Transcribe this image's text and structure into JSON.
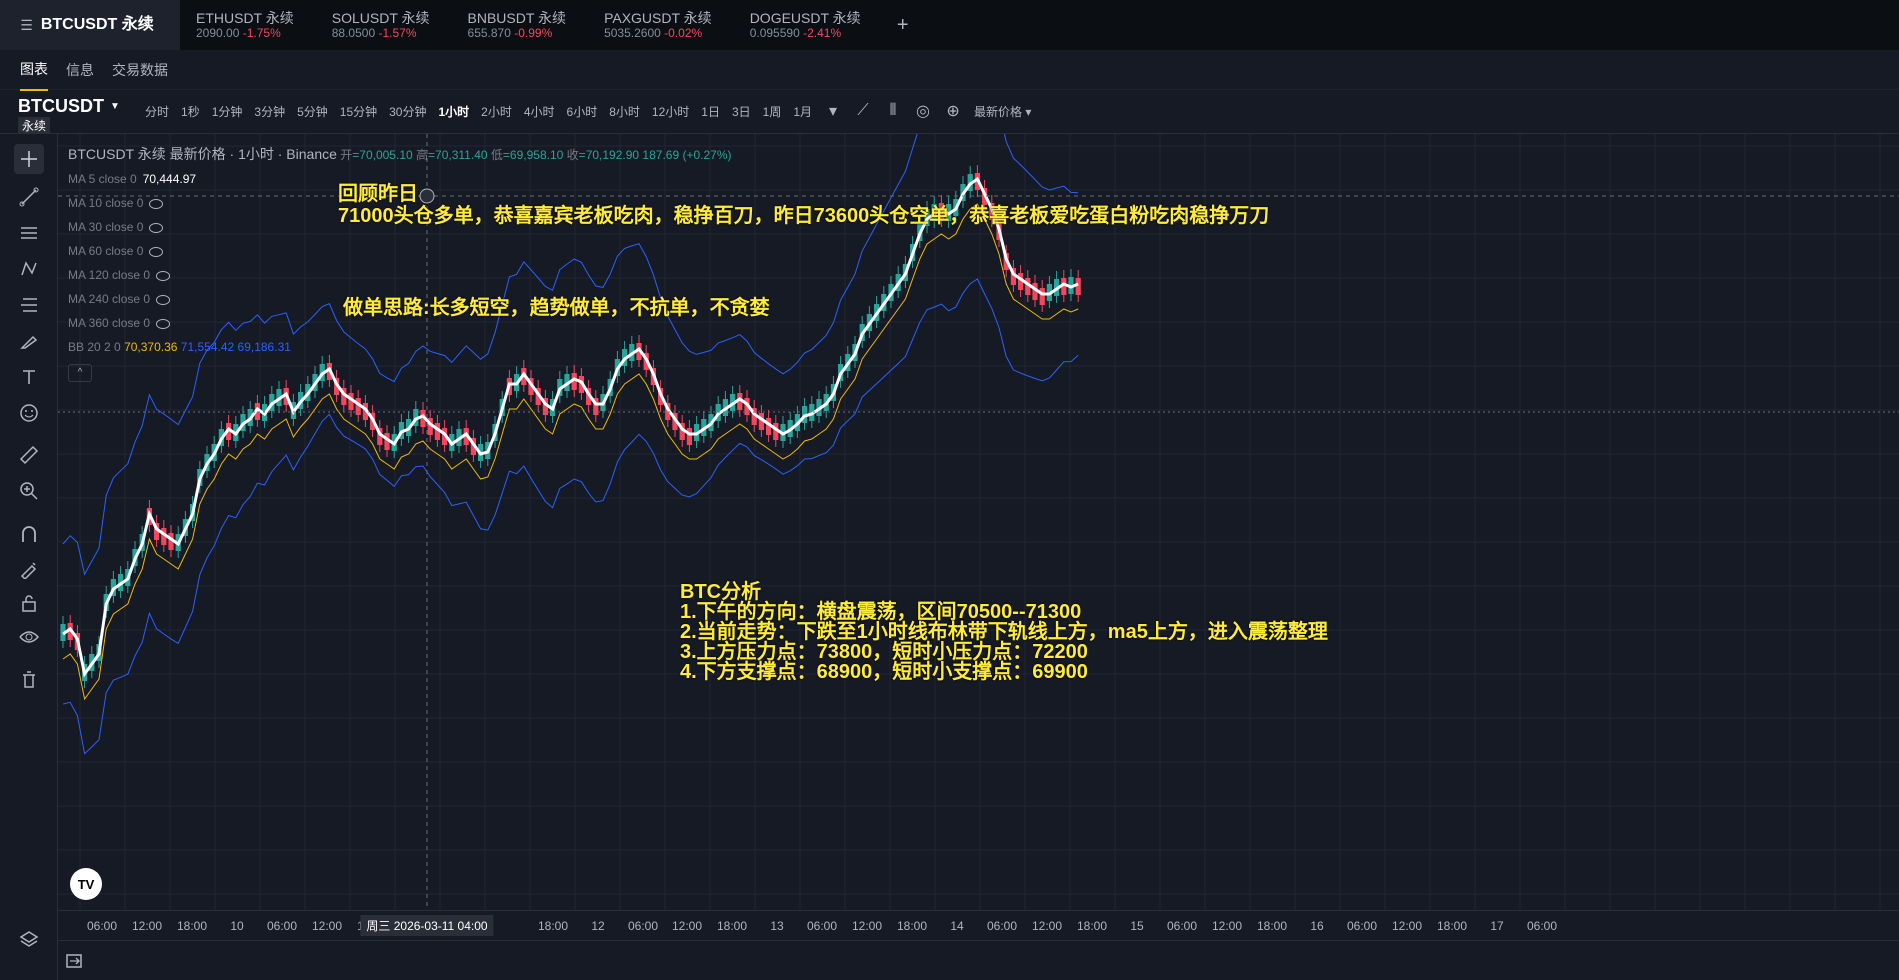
{
  "tabs": [
    {
      "name": "BTCUSDT 永续",
      "sub": "",
      "change": "",
      "active": true
    },
    {
      "name": "ETHUSDT 永续",
      "sub": "2090.00",
      "change": "-1.75%"
    },
    {
      "name": "SOLUSDT 永续",
      "sub": "88.0500",
      "change": "-1.57%"
    },
    {
      "name": "BNBUSDT 永续",
      "sub": "655.870",
      "change": "-0.99%"
    },
    {
      "name": "PAXGUSDT 永续",
      "sub": "5035.2600",
      "change": "-0.02%"
    },
    {
      "name": "DOGEUSDT 永续",
      "sub": "0.095590",
      "change": "-2.41%"
    }
  ],
  "plus_label": "+",
  "subtabs": [
    "图表",
    "信息",
    "交易数据"
  ],
  "symbol": {
    "name": "BTCUSDT",
    "type": "永续"
  },
  "intervals": [
    "分时",
    "1秒",
    "1分钟",
    "3分钟",
    "5分钟",
    "15分钟",
    "30分钟",
    "1小时",
    "2小时",
    "4小时",
    "6小时",
    "8小时",
    "12小时",
    "1日",
    "3日",
    "1周",
    "1月"
  ],
  "active_interval": "1小时",
  "price_type": "最新价格",
  "legend": {
    "title": "BTCUSDT 永续 最新价格 · 1小时 · Binance",
    "open_label": "开",
    "open": "70,005.10",
    "high_label": "高",
    "high": "70,311.40",
    "low_label": "低",
    "low": "69,958.10",
    "close_label": "收",
    "close": "70,192.90",
    "change": "187.69 (+0.27%)",
    "ma": [
      {
        "label": "MA 5 close 0",
        "value": "70,444.97"
      },
      {
        "label": "MA 10 close 0",
        "value": ""
      },
      {
        "label": "MA 30 close 0",
        "value": ""
      },
      {
        "label": "MA 60 close 0",
        "value": ""
      },
      {
        "label": "MA 120 close 0",
        "value": ""
      },
      {
        "label": "MA 240 close 0",
        "value": ""
      },
      {
        "label": "MA 360 close 0",
        "value": ""
      }
    ],
    "bb": {
      "label": "BB 20 2 0",
      "basis": "70,370.36",
      "upper": "71,554.42",
      "lower": "69,186.31"
    },
    "collapse": "^"
  },
  "annotations": {
    "review_title": "回顾昨日",
    "review_body": "71000头仓多单，恭喜嘉宾老板吃肉，稳挣百刀，昨日73600头仓空单，恭喜老板爱吃蛋白粉吃肉稳挣万刀",
    "strategy": "做单思路:长多短空，趋势做单，不抗单，不贪婪",
    "analysis": [
      "BTC分析",
      "1.下午的方向：横盘震荡，区间70500--71300",
      "2.当前走势：下跌至1小时线布林带下轨线上方，ma5上方，进入震荡整理",
      "3.上方压力点：73800，短时小压力点：72200",
      "4.下方支撑点：68900，短时小支撑点：69900"
    ]
  },
  "time_axis": [
    "06:00",
    "12:00",
    "18:00",
    "10",
    "06:00",
    "12:00",
    "18:00",
    "周三 2026-03-11",
    "04:00",
    "18:00",
    "12",
    "06:00",
    "12:00",
    "18:00",
    "13",
    "06:00",
    "12:00",
    "18:00",
    "14",
    "06:00",
    "12:00",
    "18:00",
    "15",
    "06:00",
    "12:00",
    "18:00",
    "16",
    "06:00",
    "12:00",
    "18:00",
    "17",
    "06:00"
  ],
  "crosshair_time": "周三 2026-03-11   04:00",
  "logo": "TV",
  "colors": {
    "up": "#26a69a",
    "down": "#f6465d",
    "ma5": "#ffffff",
    "bb_basis": "#f0b90b",
    "bb_band": "#2962ff",
    "annot": "#ffeb3b"
  }
}
